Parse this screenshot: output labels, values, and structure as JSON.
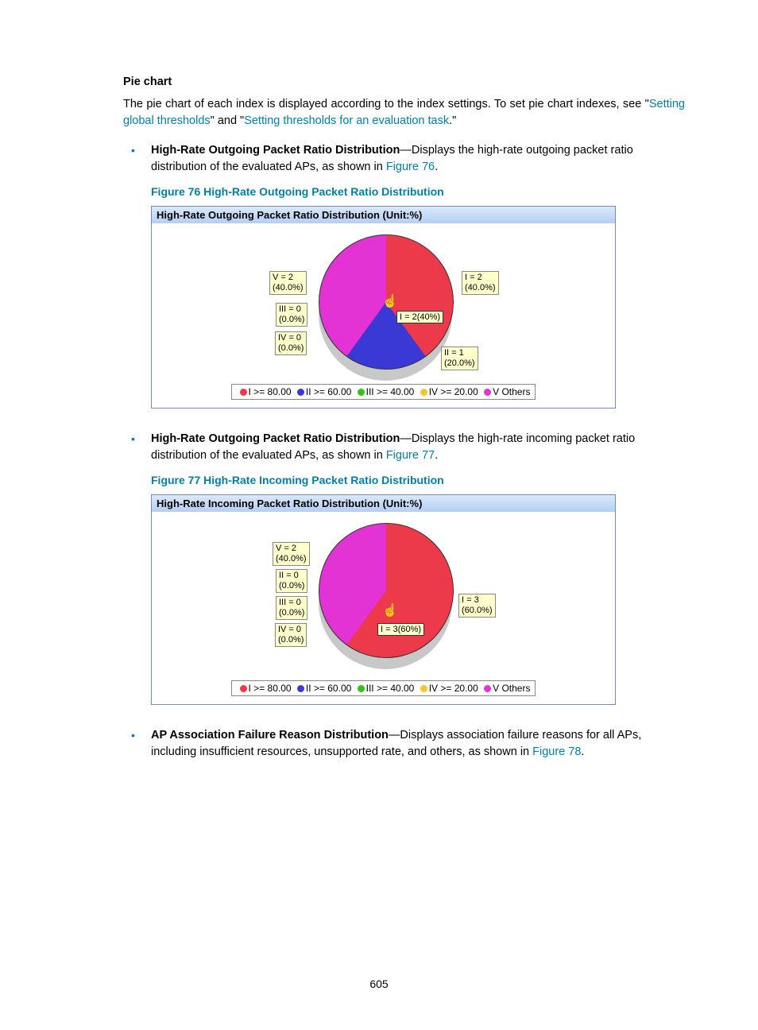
{
  "section_title": "Pie chart",
  "intro": {
    "pre": "The pie chart of each index is displayed according to the index settings. To set pie chart indexes, see \"",
    "link1": "Setting global thresholds",
    "mid": "\" and \"",
    "link2": "Setting thresholds for an evaluation task",
    "post": ".\""
  },
  "item1": {
    "bold": "High-Rate Outgoing Packet Ratio Distribution",
    "desc": "—Displays the high-rate outgoing packet ratio distribution of the evaluated APs, as shown in ",
    "figref": "Figure 76",
    "period": "."
  },
  "fig76": {
    "caption": "Figure 76 High-Rate Outgoing Packet Ratio Distribution",
    "title": "High-Rate Outgoing Packet Ratio Distribution (Unit:%)",
    "tooltip": "I = 2(40%)",
    "callouts": {
      "v": "V = 2\n(40.0%)",
      "i": "I = 2\n(40.0%)",
      "iii": "III = 0\n(0.0%)",
      "iv": "IV = 0\n(0.0%)",
      "ii": "II = 1\n(20.0%)"
    }
  },
  "legend": {
    "i": "I >= 80.00",
    "ii": "II >= 60.00",
    "iii": "III >= 40.00",
    "iv": "IV >= 20.00",
    "v": "V Others"
  },
  "item2": {
    "bold": "High-Rate Outgoing Packet Ratio Distribution",
    "desc": "—Displays the high-rate incoming packet ratio distribution of the evaluated APs, as shown in ",
    "figref": "Figure 77",
    "period": "."
  },
  "fig77": {
    "caption": "Figure 77 High-Rate Incoming Packet Ratio Distribution",
    "title": "High-Rate Incoming Packet Ratio Distribution (Unit:%)",
    "tooltip": "I = 3(60%)",
    "callouts": {
      "v": "V = 2\n(40.0%)",
      "ii": "II = 0\n(0.0%)",
      "iii": "III = 0\n(0.0%)",
      "iv": "IV = 0\n(0.0%)",
      "i": "I = 3\n(60.0%)"
    }
  },
  "item3": {
    "bold": "AP Association Failure Reason Distribution",
    "desc": "—Displays association failure reasons for all APs, including insufficient resources, unsupported rate, and others, as shown in ",
    "figref": "Figure 78",
    "period": "."
  },
  "page_number": "605",
  "chart_data": [
    {
      "type": "pie",
      "title": "High-Rate Outgoing Packet Ratio Distribution (Unit:%)",
      "series": [
        {
          "name": "I >= 80.00",
          "count": 2,
          "value": 40.0,
          "color": "#ed3a4a"
        },
        {
          "name": "II >= 60.00",
          "count": 1,
          "value": 20.0,
          "color": "#3b39d6"
        },
        {
          "name": "III >= 40.00",
          "count": 0,
          "value": 0.0,
          "color": "#33c315"
        },
        {
          "name": "IV >= 20.00",
          "count": 0,
          "value": 0.0,
          "color": "#f5c72a"
        },
        {
          "name": "V Others",
          "count": 2,
          "value": 40.0,
          "color": "#e333d4"
        }
      ]
    },
    {
      "type": "pie",
      "title": "High-Rate Incoming Packet Ratio Distribution (Unit:%)",
      "series": [
        {
          "name": "I >= 80.00",
          "count": 3,
          "value": 60.0,
          "color": "#ed3a4a"
        },
        {
          "name": "II >= 60.00",
          "count": 0,
          "value": 0.0,
          "color": "#3b39d6"
        },
        {
          "name": "III >= 40.00",
          "count": 0,
          "value": 0.0,
          "color": "#33c315"
        },
        {
          "name": "IV >= 20.00",
          "count": 0,
          "value": 0.0,
          "color": "#f5c72a"
        },
        {
          "name": "V Others",
          "count": 2,
          "value": 40.0,
          "color": "#e333d4"
        }
      ]
    }
  ]
}
